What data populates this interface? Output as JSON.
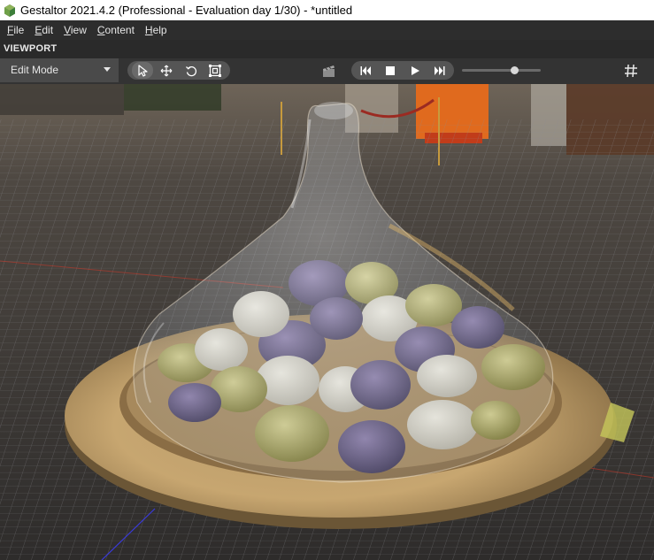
{
  "window": {
    "title": "Gestaltor 2021.4.2 (Professional - Evaluation day 1/30) - *untitled"
  },
  "menu": {
    "items": [
      {
        "first": "F",
        "rest": "ile"
      },
      {
        "first": "E",
        "rest": "dit"
      },
      {
        "first": "V",
        "rest": "iew"
      },
      {
        "first": "C",
        "rest": "ontent"
      },
      {
        "first": "H",
        "rest": "elp"
      }
    ]
  },
  "panel": {
    "title": "VIEWPORT"
  },
  "toolbar": {
    "mode_value": "Edit Mode",
    "zoom_fraction": 0.69
  },
  "viewport": {
    "background_color": "#3a3633",
    "grid_color": "#8a8c91",
    "glass_tint": "#c8a77a"
  }
}
